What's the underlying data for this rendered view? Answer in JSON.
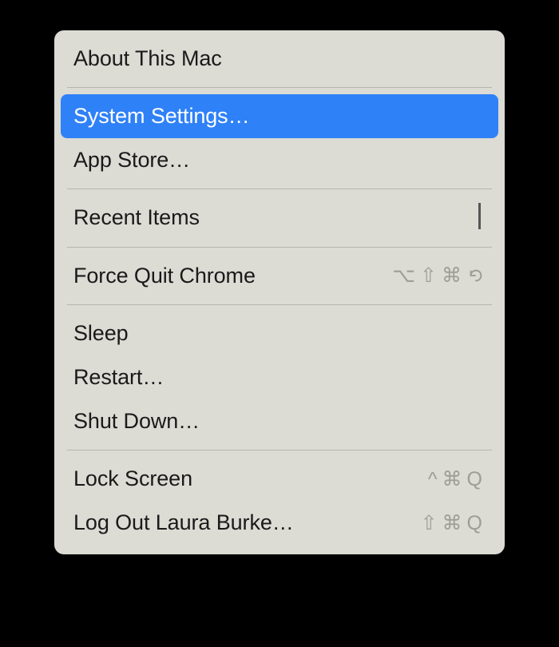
{
  "menu": {
    "groups": [
      {
        "items": [
          {
            "label": "About This Mac"
          }
        ]
      },
      {
        "items": [
          {
            "label": "System Settings…",
            "highlighted": true
          },
          {
            "label": "App Store…"
          }
        ]
      },
      {
        "items": [
          {
            "label": "Recent Items",
            "submenu": true
          }
        ]
      },
      {
        "items": [
          {
            "label": "Force Quit Chrome",
            "shortcut": [
              "⌥",
              "⇧",
              "⌘",
              "⎋"
            ]
          }
        ]
      },
      {
        "items": [
          {
            "label": "Sleep"
          },
          {
            "label": "Restart…"
          },
          {
            "label": "Shut Down…"
          }
        ]
      },
      {
        "items": [
          {
            "label": "Lock Screen",
            "shortcut": [
              "^",
              "⌘",
              "Q"
            ]
          },
          {
            "label": "Log Out Laura Burke…",
            "shortcut": [
              "⇧",
              "⌘",
              "Q"
            ]
          }
        ]
      }
    ]
  }
}
